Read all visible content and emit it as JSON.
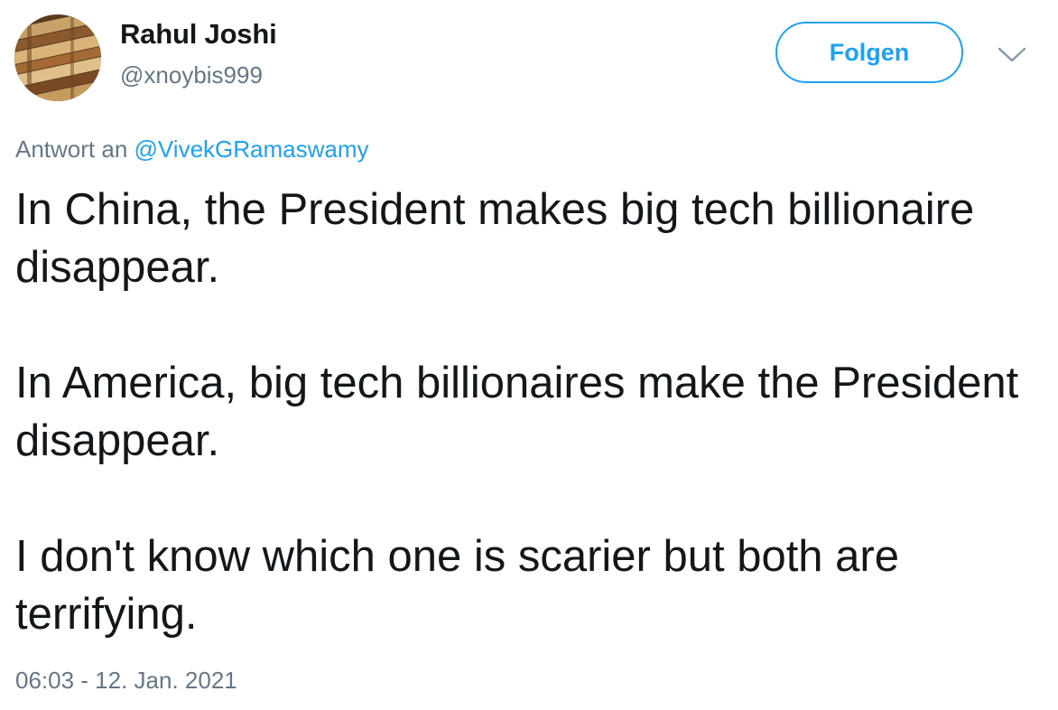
{
  "author": {
    "display_name": "Rahul Joshi",
    "handle": "@xnoybis999"
  },
  "follow_button": {
    "label": "Folgen",
    "color": "#1da1f2"
  },
  "more_menu": {
    "icon": "chevron-down-icon"
  },
  "reply_context": {
    "prefix": "Antwort an",
    "mention": "@VivekGRamaswamy"
  },
  "tweet": {
    "paragraphs": [
      "In China, the President makes big tech billionaire disappear.",
      "In America, big tech billionaires make the President disappear.",
      "I don't know which one is scarier but both are terrifying."
    ],
    "timestamp": "06:03 - 12. Jan. 2021"
  },
  "colors": {
    "text_primary": "#14171a",
    "text_secondary": "#657786",
    "accent": "#1da1f2"
  }
}
